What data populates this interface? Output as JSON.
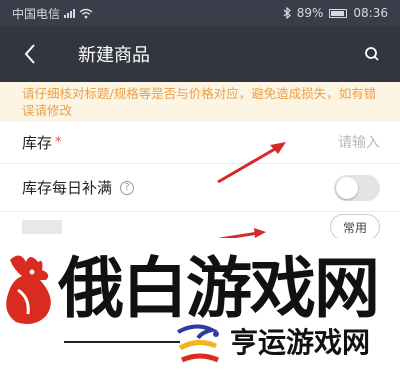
{
  "status_bar": {
    "carrier": "中国电信",
    "battery": "89%",
    "time": "08:36"
  },
  "nav": {
    "title": "新建商品",
    "back_icon": "chevron-left-icon",
    "search_icon": "search-icon"
  },
  "notice": {
    "text": "请仔细核对标题/规格等是否与价格对应，避免造成损失，如有错误请修改"
  },
  "form": {
    "stock": {
      "label": "库存",
      "required_mark": "*",
      "placeholder": "请输入"
    },
    "daily_refill": {
      "label": "库存每日补满",
      "help_icon": "help-icon",
      "toggle_on": false
    },
    "third_row": {
      "button_label": "常用"
    }
  },
  "watermark": {
    "main_text": "俄白游戏网",
    "sub_text": "亨运游戏网"
  },
  "colors": {
    "nav_bg": "#33363f",
    "notice_bg": "#fdf5e4",
    "notice_text": "#e8a04a",
    "required": "#e84a4a",
    "arrow": "#d42a2a",
    "logo_red": "#d92b1f"
  }
}
